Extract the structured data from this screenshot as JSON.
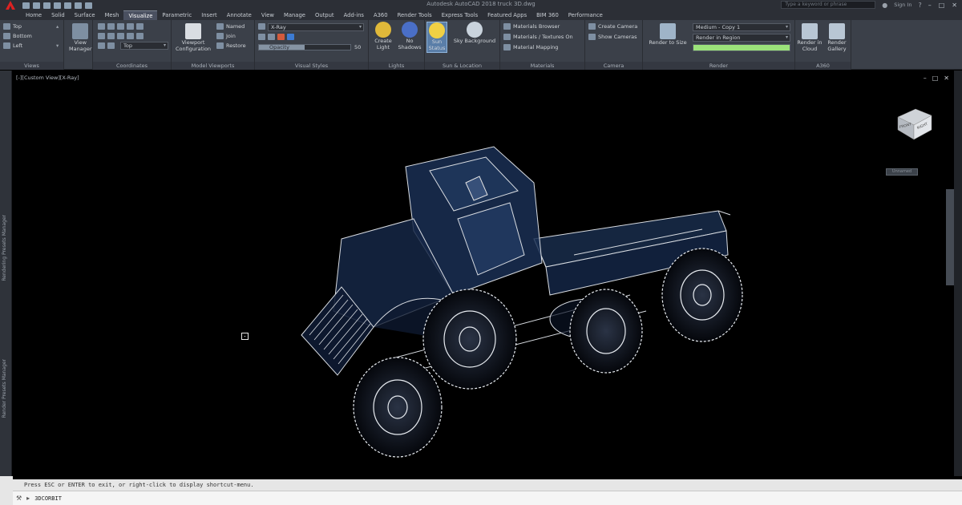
{
  "app": {
    "title": "Autodesk AutoCAD 2018   truck 3D.dwg",
    "search_placeholder": "Type a keyword or phrase",
    "signin": "Sign In"
  },
  "tabs": [
    "Home",
    "Solid",
    "Surface",
    "Mesh",
    "Visualize",
    "Parametric",
    "Insert",
    "Annotate",
    "View",
    "Manage",
    "Output",
    "Add-ins",
    "A360",
    "Render Tools",
    "Express Tools",
    "Featured Apps",
    "BIM 360",
    "Performance"
  ],
  "active_tab": "Visualize",
  "ribbon": {
    "views": {
      "title": "Views",
      "items": [
        "Top",
        "Bottom",
        "Left"
      ]
    },
    "view_manager": {
      "label1": "View",
      "label2": "Manager"
    },
    "coordinates": {
      "title": "Coordinates",
      "ucs_value": "Top"
    },
    "model_viewports": {
      "title": "Model Viewports",
      "viewport_config1": "Viewport",
      "viewport_config2": "Configuration",
      "named": "Named",
      "join": "Join",
      "restore": "Restore"
    },
    "visual_styles": {
      "title": "Visual Styles",
      "style_value": "X-Ray",
      "slider_label": "Opacity",
      "slider_value": "50",
      "opacity_level": 0.5
    },
    "lights": {
      "title": "Lights",
      "create_light1": "Create",
      "create_light2": "Light",
      "no_shadows1": "No",
      "no_shadows2": "Shadows"
    },
    "sun_location": {
      "title": "Sun & Location",
      "sun_status1": "Sun",
      "sun_status2": "Status",
      "sky": "Sky Background"
    },
    "materials": {
      "title": "Materials",
      "browser": "Materials Browser",
      "textures": "Materials / Textures On",
      "mapping": "Material Mapping"
    },
    "camera": {
      "title": "Camera",
      "create": "Create Camera",
      "show": "Show Cameras"
    },
    "render": {
      "title": "Render",
      "render_to_size1": "Render to Size",
      "preset": "Medium - Copy 1",
      "region": "Render in Region",
      "progress": 1.0
    },
    "a360": {
      "title": "A360",
      "render_cloud1": "Render in",
      "render_cloud2": "Cloud",
      "gallery1": "Render",
      "gallery2": "Gallery"
    }
  },
  "side_palettes": [
    "Rendering Presets Manager",
    "Render Presets Manager"
  ],
  "viewport": {
    "label": "[-][Custom View][X-Ray]",
    "wcs": "Unnamed",
    "viewcube_front": "FRONT",
    "viewcube_right": "RIGHT"
  },
  "command": {
    "history": "Press ESC or ENTER to exit, or right-click to display shortcut-menu.",
    "current": "3DCORBIT"
  },
  "colors": {
    "ribbon_bg": "#3b4049",
    "titlebar_bg": "#2c2f36",
    "viewport_bg": "#000000",
    "truck_tint": "#1f3658"
  }
}
